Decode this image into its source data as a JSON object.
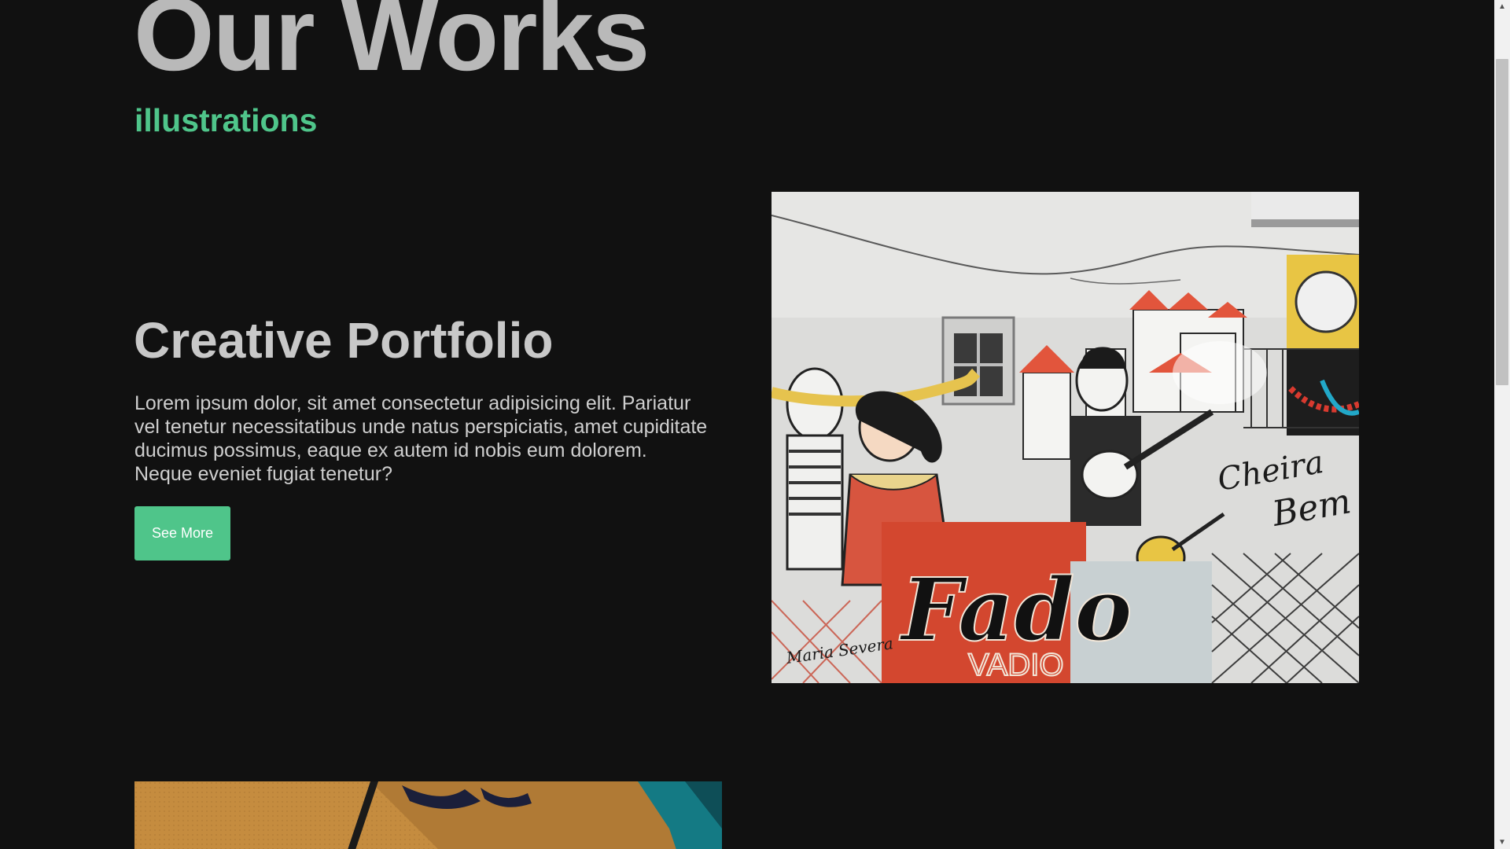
{
  "header": {
    "title": "Our Works",
    "subtitle": "illustrations"
  },
  "project": {
    "title": "Creative Portfolio",
    "description": "Lorem ipsum dolor, sit amet consectetur adipisicing elit. Pariatur vel tenetur necessitatibus unde natus perspiciatis, amet cupiditate ducimus possimus, eaque ex autem id nobis eum dolorem. Neque eveniet fugiat tenetur?",
    "button_label": "See More"
  },
  "artwork_1": {
    "sign_text": "Fado",
    "sign_text_2": "VADIO",
    "banner_left": "Maria Severa",
    "banner_right_1": "Cheira",
    "banner_right_2": "Bem"
  },
  "icons": {
    "scroll_up": "scroll-up-arrow-icon",
    "scroll_down": "scroll-down-arrow-icon"
  },
  "colors": {
    "background": "#111111",
    "accent": "#4fc58a",
    "heading": "#b9b9b9",
    "text": "#cfcfcf"
  }
}
